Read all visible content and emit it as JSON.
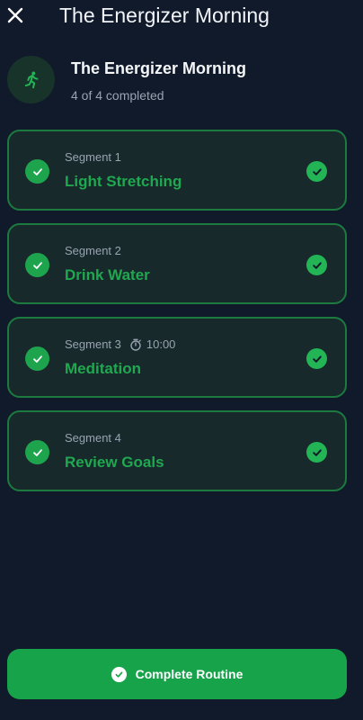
{
  "header": {
    "title": "The Energizer Morning",
    "close_icon": "close-icon"
  },
  "routine": {
    "name": "The Energizer Morning",
    "progress_text": "4 of 4 completed",
    "completed": 4,
    "total": 4,
    "icon": "running-person-icon"
  },
  "segments": [
    {
      "label": "Segment 1",
      "title": "Light Stretching",
      "timer": "",
      "completed": true
    },
    {
      "label": "Segment 2",
      "title": "Drink Water",
      "timer": "",
      "completed": true
    },
    {
      "label": "Segment 3",
      "title": "Meditation",
      "timer": "10:00",
      "completed": true
    },
    {
      "label": "Segment 4",
      "title": "Review Goals",
      "timer": "",
      "completed": true
    }
  ],
  "footer": {
    "complete_label": "Complete Routine",
    "icon": "check-circle-icon"
  },
  "colors": {
    "background": "#111a2b",
    "accent": "#16a34a",
    "card_border": "#1c7a3f",
    "card_background": "#17292b",
    "segment_title": "#1fa84f"
  }
}
